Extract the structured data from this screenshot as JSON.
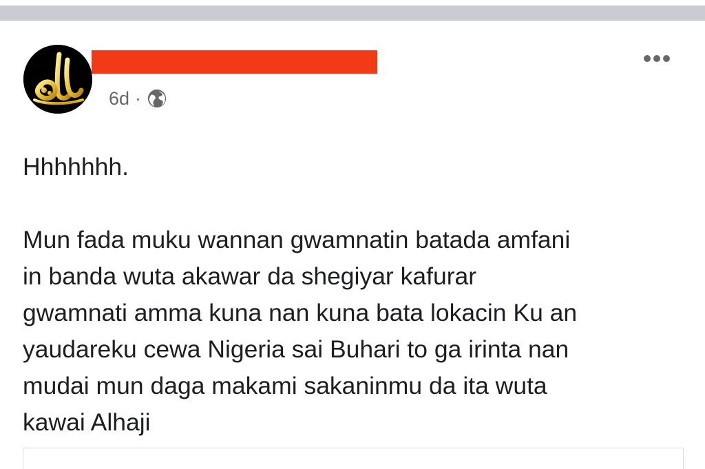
{
  "post": {
    "author": {
      "avatar_icon": "allah-calligraphy-logo-icon",
      "name_redacted": true,
      "redaction_color": "#f23a17"
    },
    "timestamp": "6d",
    "separator": "·",
    "audience_icon": "globe-icon",
    "more_icon": "more-options-icon",
    "text": {
      "first_line": "Hhhhhhh.",
      "body_lines": [
        "Mun fada muku wannan gwamnatin batada amfani",
        "in banda wuta akawar da shegiyar kafurar",
        "gwamnati amma kuna nan kuna bata lokacin Ku an",
        "yaudareku cewa Nigeria sai Buhari to ga irinta nan",
        "mudai mun daga makami sakaninmu da ita wuta",
        "kawai Alhaji"
      ]
    }
  },
  "colors": {
    "divider": "#c9ccd1",
    "meta_text": "#65676b",
    "body_text": "#1c1e21"
  }
}
